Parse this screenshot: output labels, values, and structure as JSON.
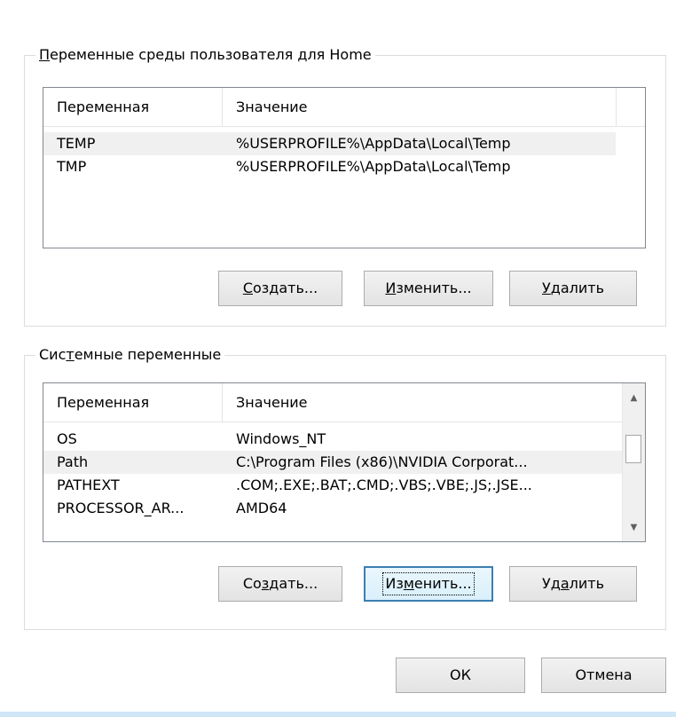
{
  "user_group": {
    "title_mnemonic": "П",
    "title_rest": "еременные среды пользователя для Home",
    "columns": [
      "Переменная",
      "Значение"
    ],
    "rows": [
      {
        "name": "TEMP",
        "value": "%USERPROFILE%\\AppData\\Local\\Temp",
        "selected": true
      },
      {
        "name": "TMP",
        "value": "%USERPROFILE%\\AppData\\Local\\Temp",
        "selected": false
      }
    ],
    "buttons": {
      "create_mnemonic": "С",
      "create_rest": "оздать...",
      "edit_mnemonic": "И",
      "edit_rest": "зменить...",
      "delete_mnemonic": "У",
      "delete_rest": "далить"
    }
  },
  "system_group": {
    "title_pre": "Сис",
    "title_mnemonic": "т",
    "title_rest": "емные переменные",
    "columns": [
      "Переменная",
      "Значение"
    ],
    "rows": [
      {
        "name": "OS",
        "value": "Windows_NT",
        "selected": false
      },
      {
        "name": "Path",
        "value": "C:\\Program Files (x86)\\NVIDIA Corporat...",
        "selected": true
      },
      {
        "name": "PATHEXT",
        "value": ".COM;.EXE;.BAT;.CMD;.VBS;.VBE;.JS;.JSE...",
        "selected": false
      },
      {
        "name": "PROCESSOR_AR...",
        "value": "AMD64",
        "selected": false
      }
    ],
    "buttons": {
      "create_pre": "Со",
      "create_mnemonic": "з",
      "create_rest": "дать...",
      "edit_pre": "Из",
      "edit_mnemonic": "м",
      "edit_rest": "енить...",
      "delete_pre": "Уд",
      "delete_mnemonic": "а",
      "delete_rest": "лить"
    }
  },
  "footer": {
    "ok_label": "ОК",
    "cancel_label": "Отмена"
  },
  "icons": {
    "scroll_up": "▲",
    "scroll_down": "▼"
  }
}
